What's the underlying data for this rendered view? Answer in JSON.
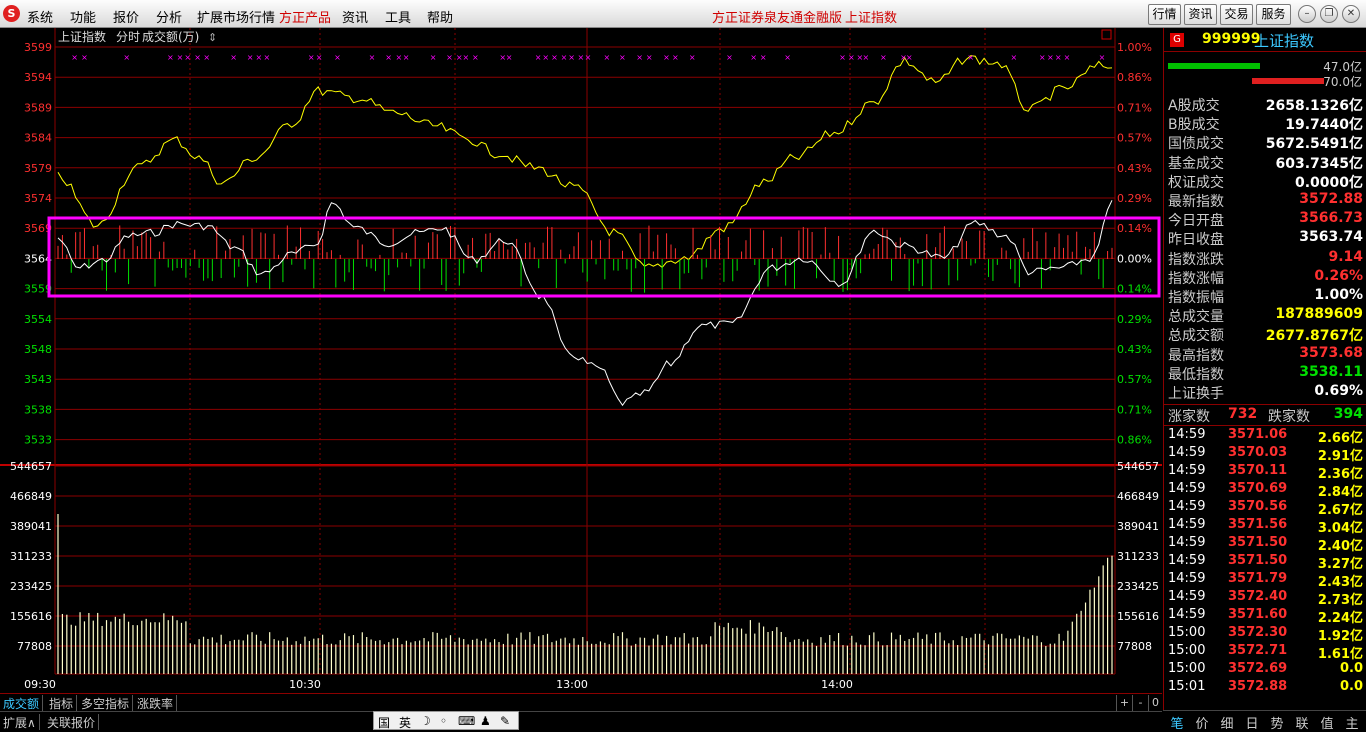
{
  "menubar": {
    "logo": "S",
    "items": [
      "系统",
      "功能",
      "报价",
      "分析",
      "扩展市场行情",
      "方正产品",
      "资讯",
      "工具",
      "帮助"
    ],
    "title": "方正证券泉友通金融版",
    "index_name": "上证指数",
    "buttons": [
      "行情",
      "资讯",
      "交易",
      "服务"
    ]
  },
  "chart_header": {
    "name": "上证指数",
    "mode": "分时",
    "indicator": "成交额(万)",
    "sort_icon": "⇕"
  },
  "price_axis": [
    "3599",
    "3594",
    "3589",
    "3584",
    "3579",
    "3574",
    "3569",
    "3564",
    "3559",
    "3554",
    "3548",
    "3543",
    "3538",
    "3533"
  ],
  "pct_axis": [
    "1.00%",
    "0.86%",
    "0.71%",
    "0.57%",
    "0.43%",
    "0.29%",
    "0.14%",
    "0.00%",
    "0.14%",
    "0.29%",
    "0.43%",
    "0.57%",
    "0.71%",
    "0.86%"
  ],
  "vol_axis": [
    "544657",
    "466849",
    "389041",
    "311233",
    "233425",
    "155616",
    "77808"
  ],
  "time_axis": [
    "09:30",
    "10:30",
    "13:00",
    "14:00"
  ],
  "bottom_tabs": [
    "成交额",
    "指标",
    "多空指标",
    "涨跌率"
  ],
  "status_tabs": [
    "扩展∧",
    "关联报价"
  ],
  "ime": [
    "国",
    "英",
    "☽",
    "◦",
    "⌨",
    "♟",
    "✎"
  ],
  "mini_buttons": [
    "+",
    "-",
    "0"
  ],
  "colors": {
    "up": "#ff3030",
    "down": "#00e000",
    "price_line": "#ffffff",
    "avg_line": "#ffff00",
    "grid": "#8b0000",
    "highlight": "#ff00ff",
    "label": "#ffffff"
  },
  "right_panel": {
    "code": "999999",
    "name": "上证指数",
    "badge": "G",
    "bar_up_value": "47.0亿",
    "bar_down_value": "70.0亿",
    "stats": [
      {
        "label": "A股成交",
        "value": "2658.1326亿",
        "color": "#ffffff"
      },
      {
        "label": "B股成交",
        "value": "19.7440亿",
        "color": "#ffffff"
      },
      {
        "label": "国债成交",
        "value": "5672.5491亿",
        "color": "#ffffff"
      },
      {
        "label": "基金成交",
        "value": "603.7345亿",
        "color": "#ffffff"
      },
      {
        "label": "权证成交",
        "value": "0.0000亿",
        "color": "#ffffff"
      },
      {
        "label": "最新指数",
        "value": "3572.88",
        "color": "#ff3030"
      },
      {
        "label": "今日开盘",
        "value": "3566.73",
        "color": "#ff3030"
      },
      {
        "label": "昨日收盘",
        "value": "3563.74",
        "color": "#ffffff"
      },
      {
        "label": "指数涨跌",
        "value": "9.14",
        "color": "#ff3030"
      },
      {
        "label": "指数涨幅",
        "value": "0.26%",
        "color": "#ff3030"
      },
      {
        "label": "指数振幅",
        "value": "1.00%",
        "color": "#ffffff"
      },
      {
        "label": "总成交量",
        "value": "187889609",
        "color": "#ffff00"
      },
      {
        "label": "总成交额",
        "value": "2677.8767亿",
        "color": "#ffff00"
      },
      {
        "label": "最高指数",
        "value": "3573.68",
        "color": "#ff3030"
      },
      {
        "label": "最低指数",
        "value": "3538.11",
        "color": "#00e000"
      },
      {
        "label": "上证换手",
        "value": "0.69%",
        "color": "#ffffff"
      }
    ],
    "up_label": "涨家数",
    "up_count": "732",
    "down_label": "跌家数",
    "down_count": "394",
    "ticks": [
      {
        "time": "14:59",
        "price": "3571.06",
        "amount": "2.66亿"
      },
      {
        "time": "14:59",
        "price": "3570.03",
        "amount": "2.91亿"
      },
      {
        "time": "14:59",
        "price": "3570.11",
        "amount": "2.36亿"
      },
      {
        "time": "14:59",
        "price": "3570.69",
        "amount": "2.84亿"
      },
      {
        "time": "14:59",
        "price": "3570.56",
        "amount": "2.67亿"
      },
      {
        "time": "14:59",
        "price": "3571.56",
        "amount": "3.04亿"
      },
      {
        "time": "14:59",
        "price": "3571.50",
        "amount": "2.40亿"
      },
      {
        "time": "14:59",
        "price": "3571.50",
        "amount": "3.27亿"
      },
      {
        "time": "14:59",
        "price": "3571.79",
        "amount": "2.43亿"
      },
      {
        "time": "14:59",
        "price": "3572.40",
        "amount": "2.73亿"
      },
      {
        "time": "14:59",
        "price": "3571.60",
        "amount": "2.24亿"
      },
      {
        "time": "15:00",
        "price": "3572.30",
        "amount": "1.92亿"
      },
      {
        "time": "15:00",
        "price": "3572.71",
        "amount": "1.61亿"
      },
      {
        "time": "15:00",
        "price": "3572.69",
        "amount": "0.0"
      },
      {
        "time": "15:01",
        "price": "3572.88",
        "amount": "0.0"
      }
    ],
    "tabs": [
      "笔",
      "价",
      "细",
      "日",
      "势",
      "联",
      "值",
      "主"
    ]
  }
}
